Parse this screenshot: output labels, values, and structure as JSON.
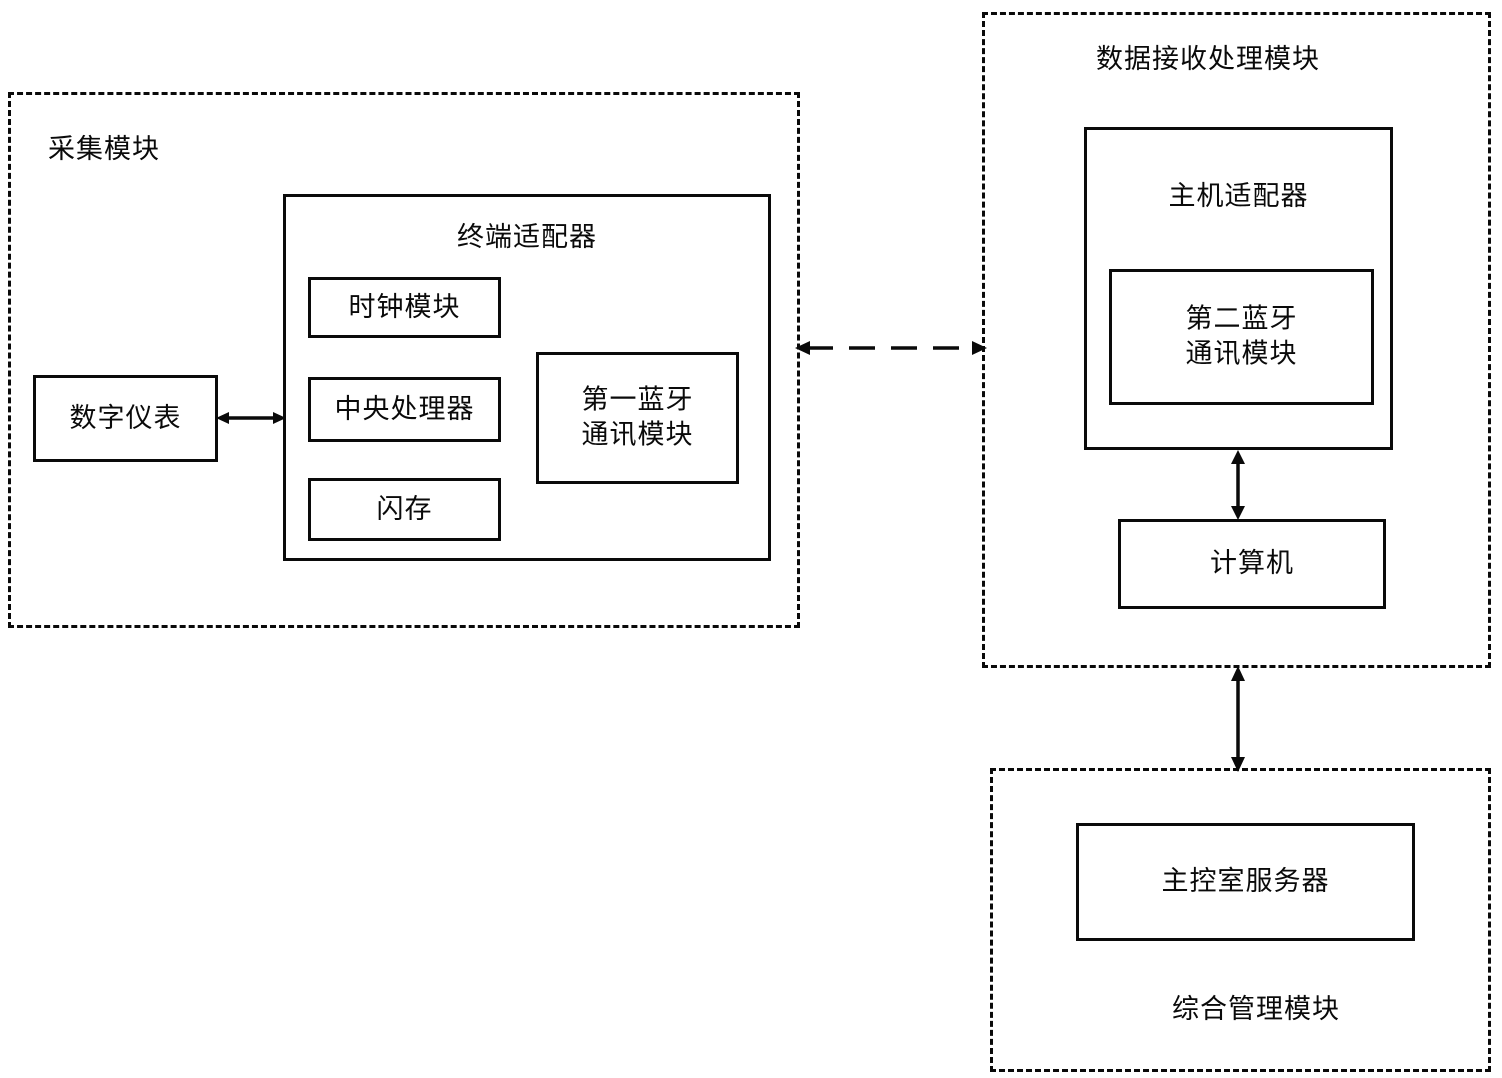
{
  "diagram": {
    "title_text_language": "zh",
    "line_color": "#0a0a0a",
    "background_color": "#ffffff"
  },
  "acquisition_module": {
    "label": "采集模块",
    "digital_instrument": {
      "label": "数字仪表"
    },
    "terminal_adapter": {
      "title": "终端适配器",
      "clock_module": {
        "label": "时钟模块"
      },
      "cpu": {
        "label": "中央处理器"
      },
      "flash": {
        "label": "闪存"
      },
      "first_bluetooth": {
        "label": "第一蓝牙\n通讯模块"
      }
    }
  },
  "data_receiving_module": {
    "label": "数据接收处理模块",
    "host_adapter": {
      "title": "主机适配器",
      "second_bluetooth": {
        "label": "第二蓝牙\n通讯模块"
      }
    },
    "computer": {
      "label": "计算机"
    }
  },
  "management_module": {
    "label": "综合管理模块",
    "control_room_server": {
      "label": "主控室服务器"
    }
  },
  "connections": {
    "instrument_to_adapter": {
      "style": "solid",
      "arrowheads": "both"
    },
    "acquisition_to_receiving": {
      "style": "dashed",
      "arrowheads": "both"
    },
    "adapter_to_computer": {
      "style": "solid",
      "arrowheads": "both"
    },
    "receiving_to_management": {
      "style": "solid",
      "arrowheads": "both"
    }
  }
}
